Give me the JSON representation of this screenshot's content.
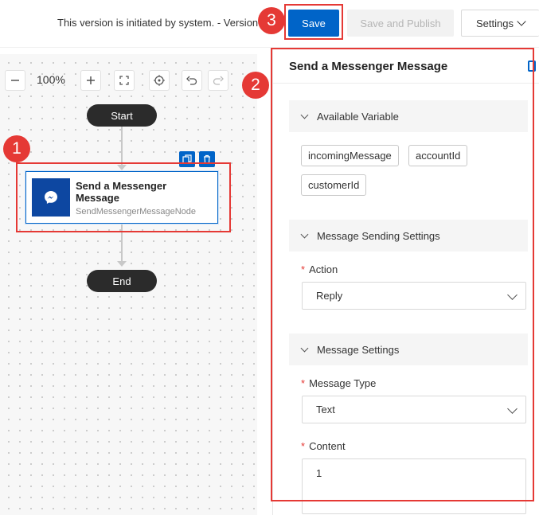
{
  "topbar": {
    "version_text": "This version is initiated by system. - Version",
    "save_label": "Save",
    "publish_label": "Save and Publish",
    "settings_label": "Settings"
  },
  "canvas": {
    "zoom": "100%",
    "start_label": "Start",
    "end_label": "End",
    "node": {
      "title": "Send a Messenger Message",
      "subtitle": "SendMessengerMessageNode",
      "icon": "messenger-icon"
    }
  },
  "annotations": {
    "badge1": "1",
    "badge2": "2",
    "badge3": "3"
  },
  "panel": {
    "title": "Send a Messenger Message",
    "available_variable": {
      "heading": "Available Variable",
      "tags": [
        "incomingMessage",
        "accountId",
        "customerId"
      ]
    },
    "sending_settings": {
      "heading": "Message Sending Settings",
      "action_label": "Action",
      "action_value": "Reply"
    },
    "message_settings": {
      "heading": "Message Settings",
      "type_label": "Message Type",
      "type_value": "Text",
      "content_label": "Content",
      "content_value": "1"
    }
  },
  "colors": {
    "accent": "#0064c8",
    "highlight": "#e53935",
    "node_icon_bg": "#0d47a1"
  }
}
